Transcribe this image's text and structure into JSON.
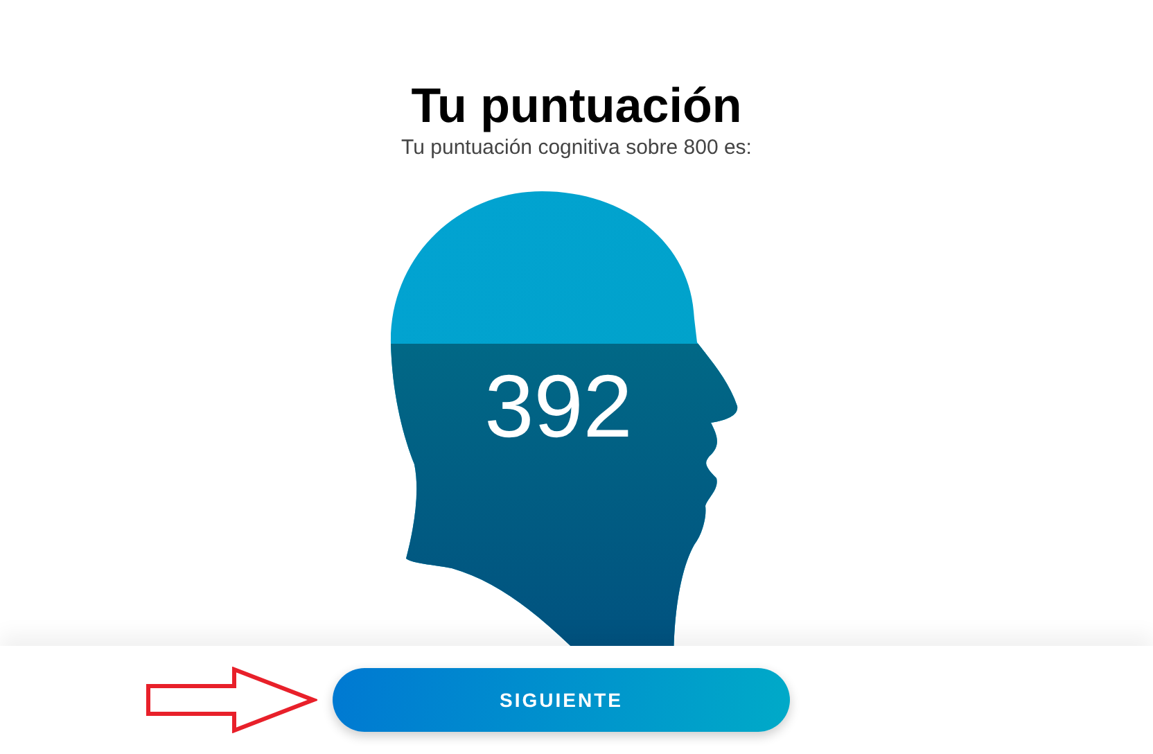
{
  "title": "Tu puntuación",
  "subtitle": "Tu puntuación cognitiva sobre 800 es:",
  "score": {
    "value": "392"
  },
  "next_button": {
    "label": "SIGUIENTE"
  }
}
